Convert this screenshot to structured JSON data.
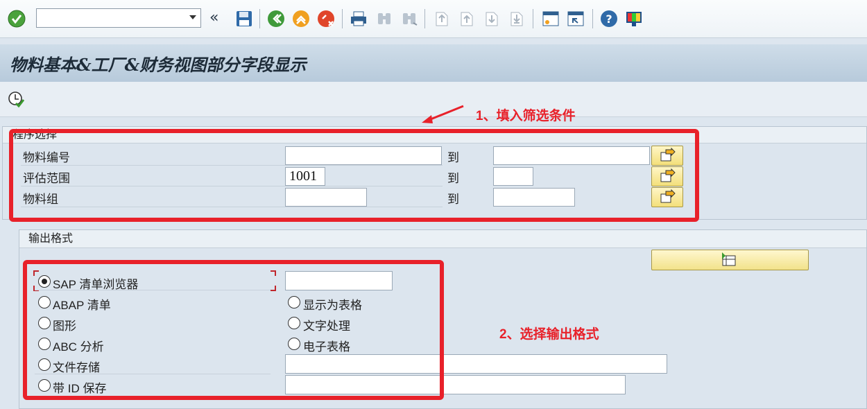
{
  "window": {
    "title": "物料基本&工厂&财务视图部分字段显示"
  },
  "toolbar": {
    "command_field": {
      "value": ""
    },
    "icons": [
      "enter-check-icon",
      "back-double-arrow-icon",
      "save-icon",
      "back-icon",
      "exit-icon",
      "cancel-icon",
      "print-icon",
      "find-icon",
      "find-next-icon",
      "first-page-icon",
      "previous-page-icon",
      "next-page-icon",
      "last-page-icon",
      "create-session-icon",
      "shortcut-icon",
      "help-icon",
      "customize-layout-icon"
    ]
  },
  "appbar": {
    "icons": [
      "execute-icon"
    ]
  },
  "selection": {
    "header": "程序选择",
    "to_label": "到",
    "rows": [
      {
        "label": "物料编号",
        "from": "",
        "to": ""
      },
      {
        "label": "评估范围",
        "from": "1001",
        "to": ""
      },
      {
        "label": "物料组",
        "from": "",
        "to": ""
      }
    ]
  },
  "output": {
    "header": "输出格式",
    "layout_value": "",
    "left_options": [
      {
        "label": "SAP 清单浏览器",
        "selected": true
      },
      {
        "label": "ABAP 清单",
        "selected": false
      },
      {
        "label": "图形",
        "selected": false
      },
      {
        "label": "ABC 分析",
        "selected": false
      },
      {
        "label": "文件存储",
        "selected": false
      },
      {
        "label": "带 ID 保存",
        "selected": false
      }
    ],
    "right_options": [
      {
        "label": "显示为表格",
        "selected": false
      },
      {
        "label": "文字处理",
        "selected": false
      },
      {
        "label": "电子表格",
        "selected": false
      }
    ],
    "file_path": "",
    "id_value": ""
  },
  "annotations": {
    "first": "1、填入筛选条件",
    "second": "2、选择输出格式",
    "color": "#e8212a"
  }
}
